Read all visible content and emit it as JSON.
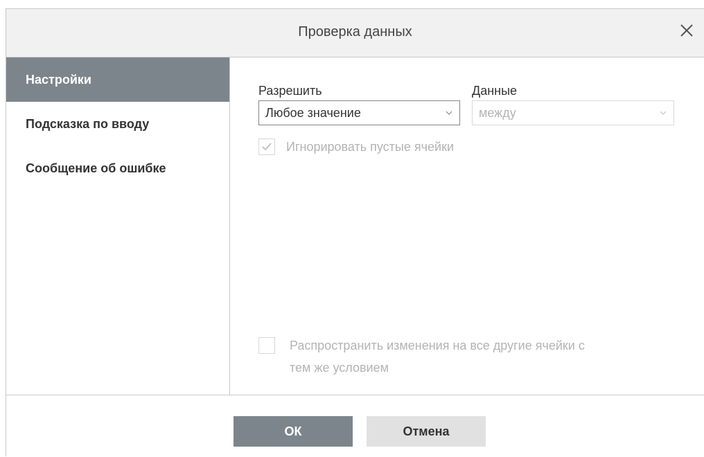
{
  "dialog": {
    "title": "Проверка данных",
    "close_icon": "close-icon"
  },
  "sidebar": {
    "items": [
      {
        "label": "Настройки",
        "active": true
      },
      {
        "label": "Подсказка по вводу",
        "active": false
      },
      {
        "label": "Сообщение об ошибке",
        "active": false
      }
    ]
  },
  "settings": {
    "allow_label": "Разрешить",
    "allow_value": "Любое значение",
    "data_label": "Данные",
    "data_value": "между",
    "ignore_blank_label": "Игнорировать пустые ячейки",
    "ignore_blank_checked": true,
    "apply_all_label_line1": "Распространить изменения на все другие ячейки с",
    "apply_all_label_line2": "тем же условием",
    "apply_all_checked": false
  },
  "footer": {
    "ok_label": "ОК",
    "cancel_label": "Отмена"
  },
  "colors": {
    "accent": "#7d858c",
    "header_bg": "#f1f1f1",
    "disabled_text": "#b3b3b3"
  }
}
